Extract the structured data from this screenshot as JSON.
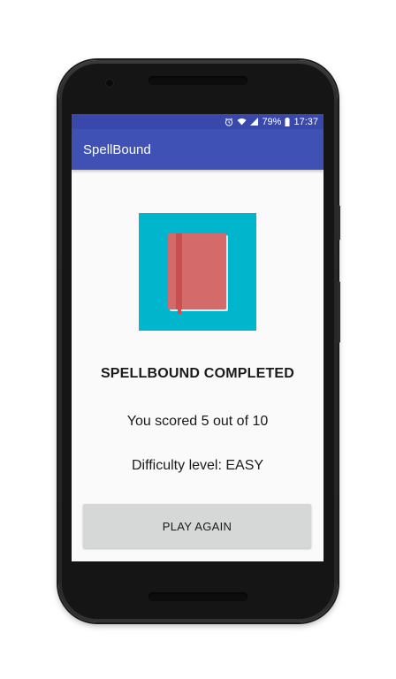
{
  "status_bar": {
    "battery": "79%",
    "time": "17:37",
    "icons": [
      "alarm-icon",
      "wifi-icon",
      "signal-icon",
      "battery-icon"
    ]
  },
  "app_bar": {
    "title": "SpellBound"
  },
  "main": {
    "hero_icon": "book-icon",
    "heading": "SPELLBOUND COMPLETED",
    "score_text": "You scored 5 out of 10",
    "difficulty_text": "Difficulty level: EASY",
    "play_again_label": "PLAY AGAIN"
  },
  "colors": {
    "status_bar": "#3949ab",
    "app_bar": "#3f51b5",
    "hero_background": "#00b5cc",
    "book": "#d46a6a",
    "button": "#d6d7d7"
  }
}
